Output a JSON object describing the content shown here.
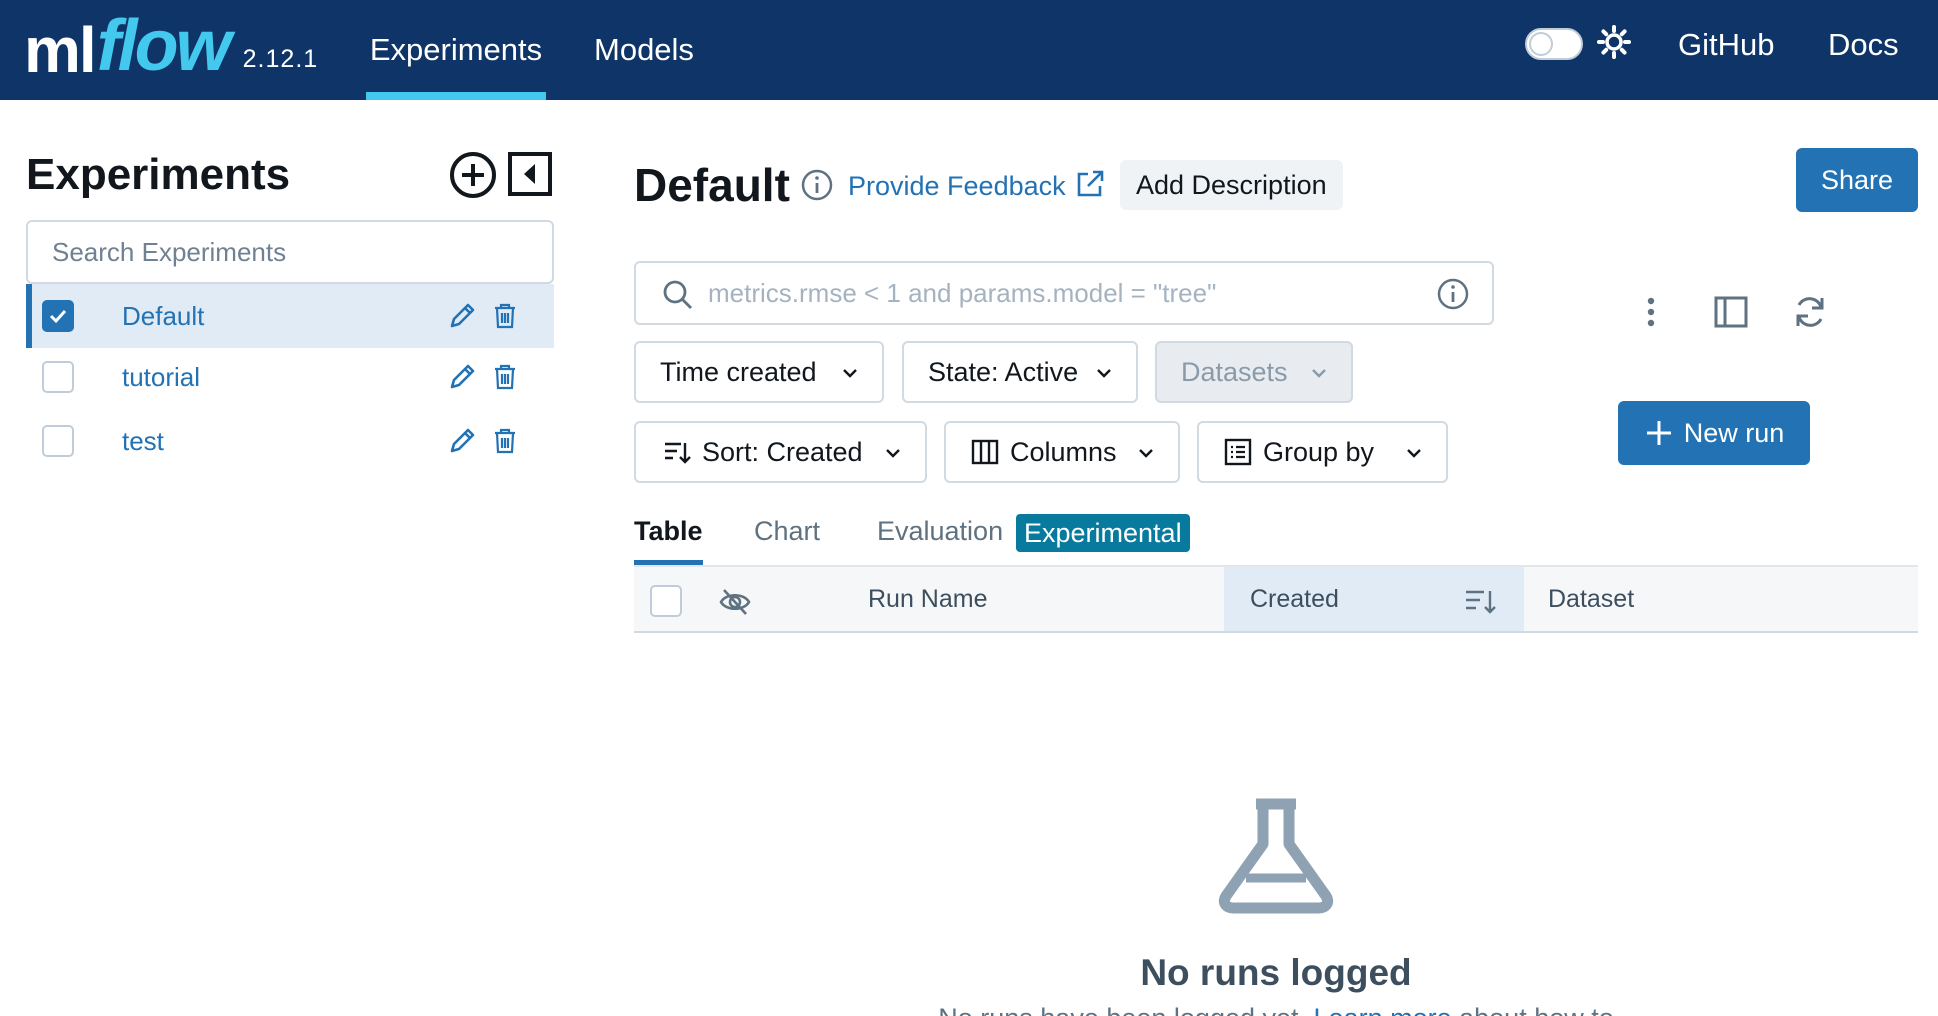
{
  "header": {
    "logo_ml": "ml",
    "logo_flow": "flow",
    "version": "2.12.1",
    "nav": [
      {
        "label": "Experiments",
        "active": true
      },
      {
        "label": "Models",
        "active": false
      }
    ],
    "github_label": "GitHub",
    "docs_label": "Docs",
    "theme_toggle_on": false,
    "colors": {
      "bar": "#0e3468",
      "accent": "#43c9ed"
    }
  },
  "sidebar": {
    "title": "Experiments",
    "search_placeholder": "Search Experiments",
    "experiments": [
      {
        "name": "Default",
        "checked": true,
        "active": true
      },
      {
        "name": "tutorial",
        "checked": false,
        "active": false
      },
      {
        "name": "test",
        "checked": false,
        "active": false
      }
    ]
  },
  "main": {
    "title": "Default",
    "feedback_label": "Provide Feedback",
    "add_description_label": "Add Description",
    "share_label": "Share",
    "search_placeholder": "metrics.rmse < 1 and params.model = \"tree\"",
    "filters": {
      "time_created": "Time created",
      "state": "State: Active",
      "datasets": "Datasets",
      "sort": "Sort: Created",
      "columns": "Columns",
      "group_by": "Group by"
    },
    "new_run_label": "New run",
    "tabs": [
      {
        "label": "Table",
        "active": true
      },
      {
        "label": "Chart",
        "active": false
      },
      {
        "label": "Evaluation",
        "active": false
      }
    ],
    "experimental_badge": "Experimental",
    "table_columns": [
      "Run Name",
      "Created",
      "Dataset"
    ],
    "empty_state": {
      "title": "No runs logged",
      "description_prefix": "No runs have been logged yet.",
      "link_label": "Learn more",
      "description_suffix": "about how to"
    },
    "colors": {
      "primary": "#2272b4",
      "badge": "#077a9d"
    }
  }
}
